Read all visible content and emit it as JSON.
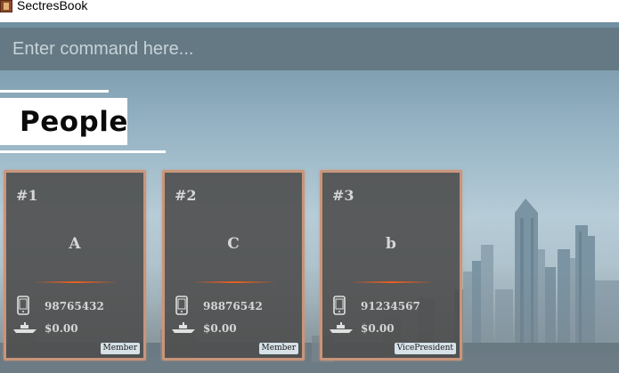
{
  "window": {
    "title": "SectresBook"
  },
  "command": {
    "placeholder": "Enter command here..."
  },
  "section": {
    "title": "People"
  },
  "people": [
    {
      "index": "#1",
      "name": "A",
      "phone": "98765432",
      "money": "$0.00",
      "tag": "Member"
    },
    {
      "index": "#2",
      "name": "C",
      "phone": "98876542",
      "money": "$0.00",
      "tag": "Member"
    },
    {
      "index": "#3",
      "name": "b",
      "phone": "91234567",
      "money": "$0.00",
      "tag": "VicePresident"
    }
  ],
  "icons": {
    "app": "book-icon",
    "phone": "phone-icon",
    "money": "ship-icon"
  },
  "colors": {
    "card_border": "#c9957a",
    "card_bg": "#4e4e4e",
    "accent_line": "#e8601f",
    "command_bar": "#647983"
  }
}
